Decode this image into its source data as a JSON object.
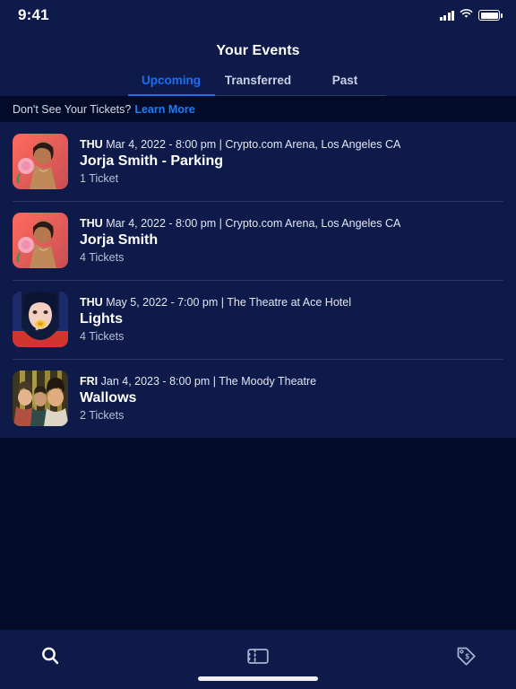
{
  "statusbar": {
    "time": "9:41",
    "signal_icon": "cellular-signal-icon",
    "wifi_icon": "wifi-icon",
    "battery_icon": "battery-icon"
  },
  "header": {
    "title": "Your Events",
    "tabs": [
      {
        "label": "Upcoming",
        "active": true
      },
      {
        "label": "Transferred",
        "active": false
      },
      {
        "label": "Past",
        "active": false
      }
    ]
  },
  "notice": {
    "text": "Don't See Your Tickets?",
    "link_label": "Learn More"
  },
  "events": [
    {
      "day_of_week": "THU",
      "datetime": "Mar 4, 2022 - 8:00 pm",
      "venue": "Crypto.com Arena, Los Angeles CA",
      "meta_separator": " | ",
      "name": "Jorja Smith - Parking",
      "tickets": "1 Ticket",
      "thumbnail": "jorja-smith-artwork"
    },
    {
      "day_of_week": "THU",
      "datetime": "Mar 4, 2022 - 8:00 pm",
      "venue": "Crypto.com Arena, Los Angeles CA",
      "meta_separator": " | ",
      "name": "Jorja Smith",
      "tickets": "4 Tickets",
      "thumbnail": "jorja-smith-artwork"
    },
    {
      "day_of_week": "THU",
      "datetime": "May 5, 2022 - 7:00 pm",
      "venue": "The Theatre at Ace Hotel",
      "meta_separator": " | ",
      "name": "Lights",
      "tickets": "4 Tickets",
      "thumbnail": "lights-artwork"
    },
    {
      "day_of_week": "FRI",
      "datetime": "Jan 4, 2023 - 8:00 pm",
      "venue": "The Moody Theatre",
      "meta_separator": " | ",
      "name": "Wallows",
      "tickets": "2 Tickets",
      "thumbnail": "wallows-artwork"
    }
  ],
  "bottom_nav": [
    {
      "icon": "search-icon"
    },
    {
      "icon": "ticket-icon"
    },
    {
      "icon": "price-tag-icon"
    }
  ],
  "colors": {
    "page_background": "#020c28",
    "panel_background": "#0d1a4a",
    "accent_blue": "#1b6ef3",
    "link_blue": "#1b7df5",
    "divider": "#2a3763",
    "primary_text": "#ffffff",
    "secondary_text": "#b9c0d4"
  }
}
